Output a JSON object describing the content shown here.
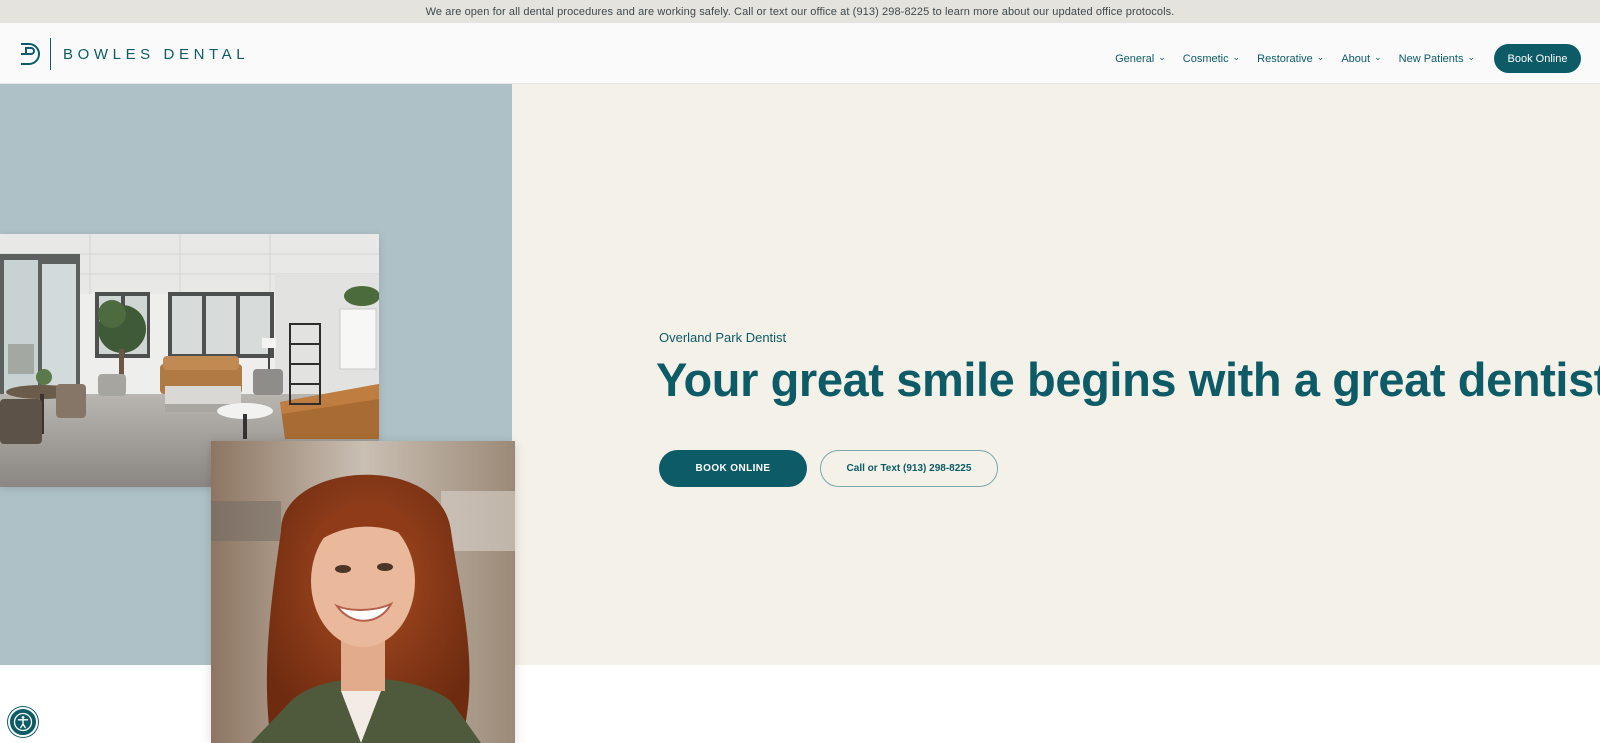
{
  "announcement": {
    "text": "We are open for all dental procedures and are working safely. Call or text our office at (913) 298-8225 to learn more about our updated office protocols."
  },
  "header": {
    "logo_text": "BOWLES DENTAL",
    "nav": [
      {
        "label": "General",
        "icon": "chevron-down-icon"
      },
      {
        "label": "Cosmetic",
        "icon": "chevron-down-icon"
      },
      {
        "label": "Restorative",
        "icon": "chevron-down-icon"
      },
      {
        "label": "About",
        "icon": "chevron-down-icon"
      },
      {
        "label": "New Patients",
        "icon": "chevron-down-icon"
      }
    ],
    "chevron": "⌄",
    "book_label": "Book Online"
  },
  "hero": {
    "eyebrow": "Overland Park Dentist",
    "headline": "Your great smile begins with a great dentist",
    "book_button": "BOOK ONLINE",
    "call_button": "Call or Text (913) 298-8225"
  },
  "colors": {
    "brand": "#0c5b66",
    "hero_left_bg": "#adc1c7",
    "hero_right_bg": "#f4f1e9",
    "announce_bg": "#e4e3de"
  },
  "icons": {
    "logo": "bowles-dental-logo-icon",
    "accessibility": "accessibility-icon"
  }
}
